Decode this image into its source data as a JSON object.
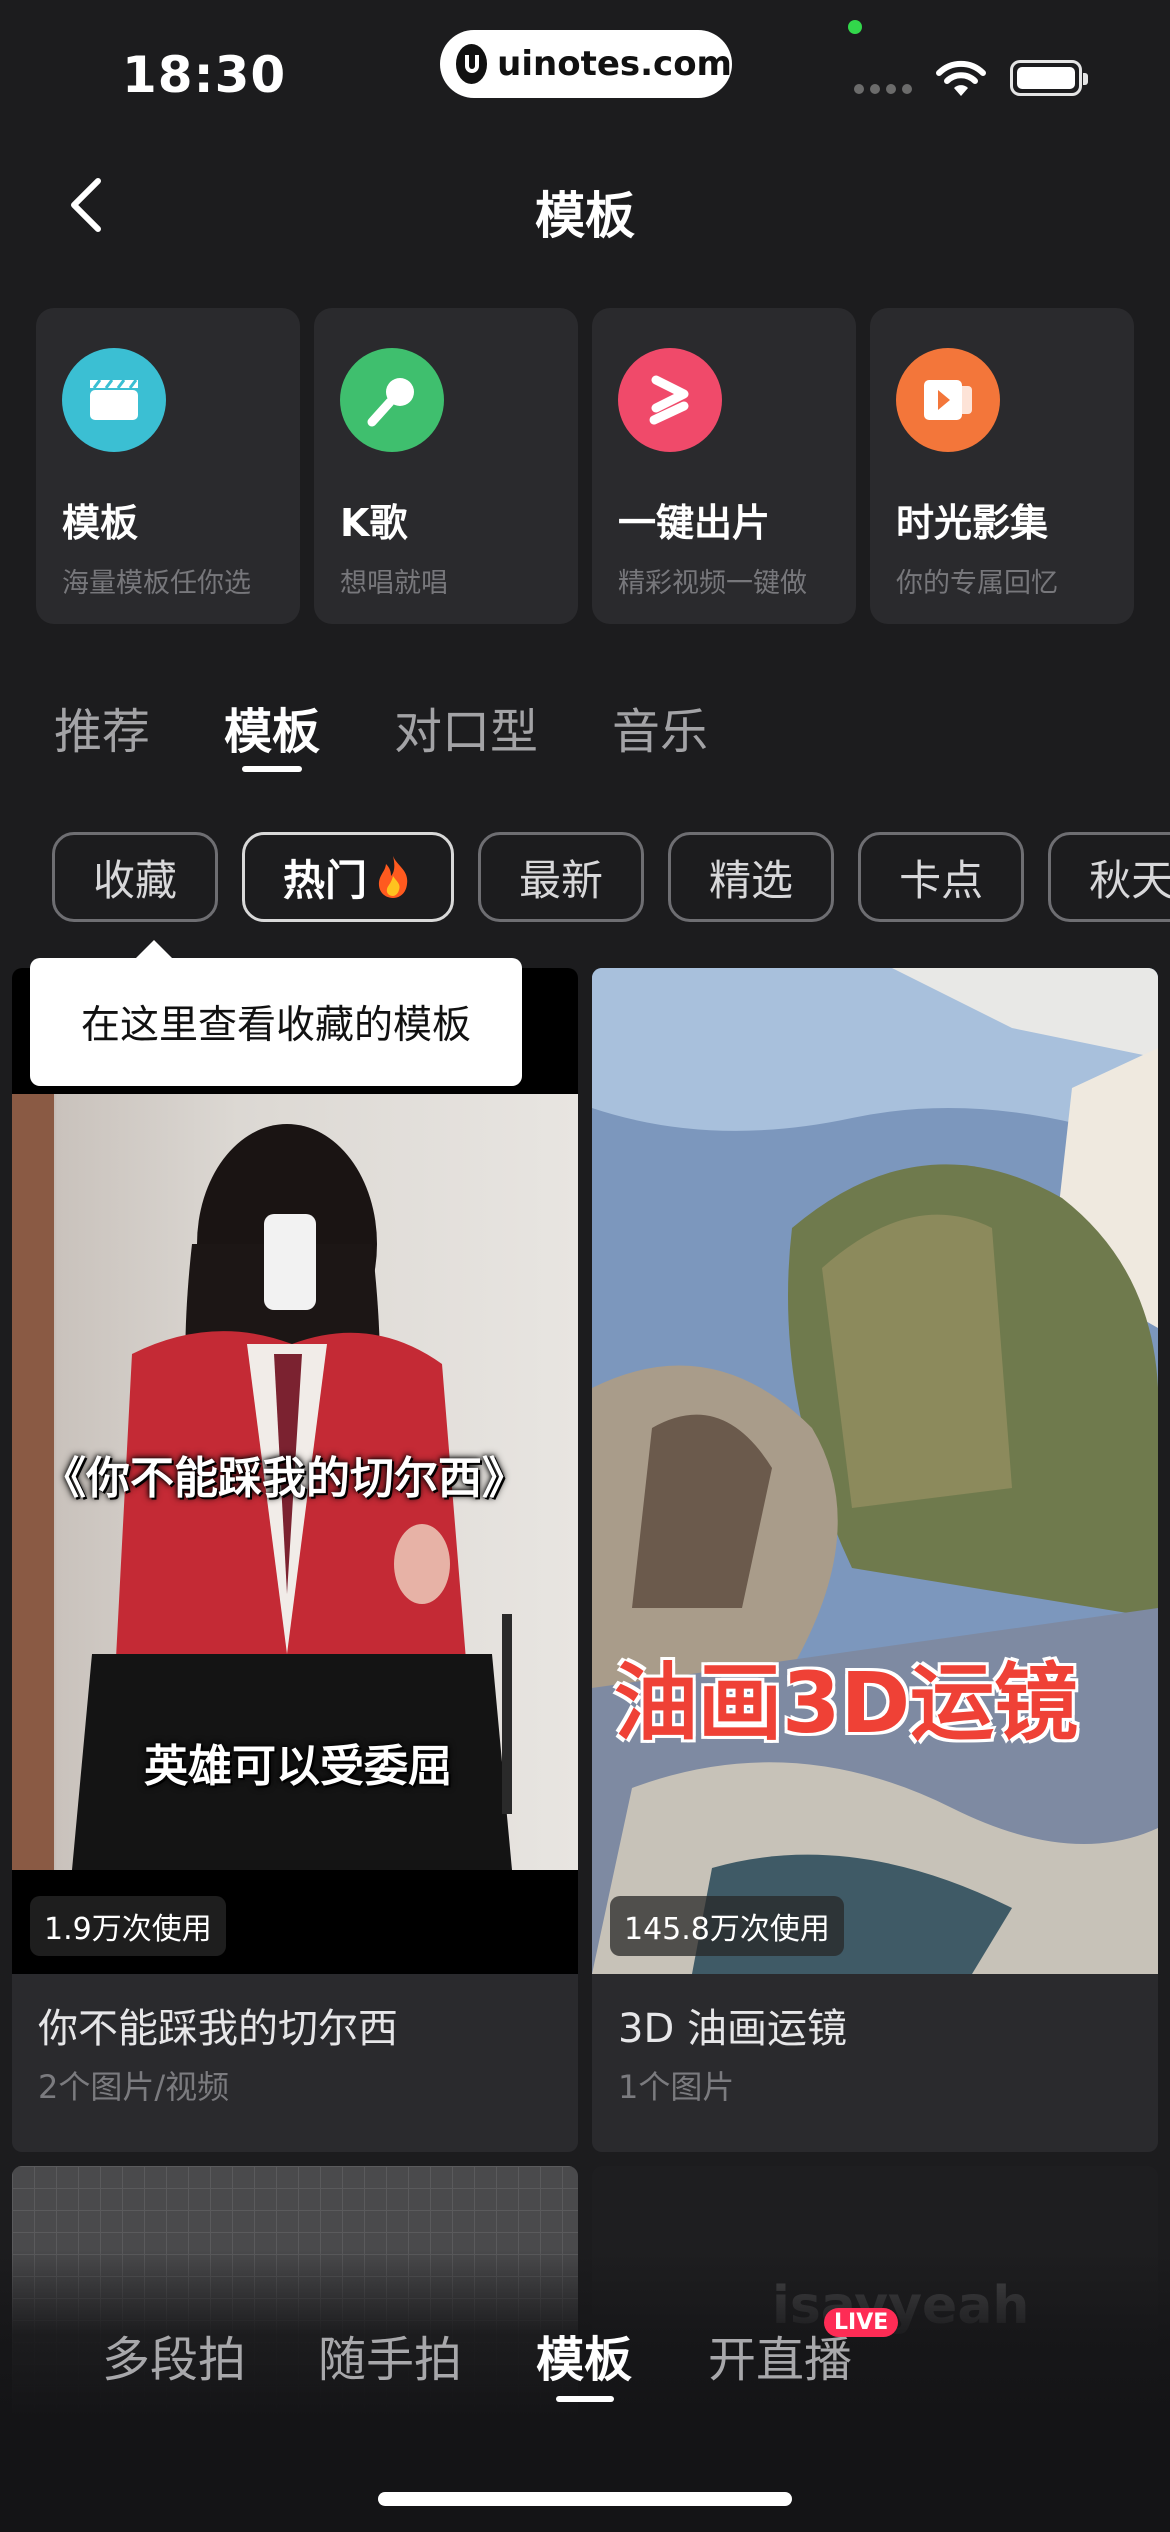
{
  "status": {
    "time": "18:30",
    "url": "uinotes.com"
  },
  "header": {
    "title": "模板"
  },
  "feature_cards": [
    {
      "title": "模板",
      "subtitle": "海量模板任你选",
      "icon": "clapperboard-icon",
      "color": "#3bbfd3"
    },
    {
      "title": "K歌",
      "subtitle": "想唱就唱",
      "icon": "microphone-icon",
      "color": "#3fbf6e"
    },
    {
      "title": "一键出片",
      "subtitle": "精彩视频一键做",
      "icon": "one-click-icon",
      "color": "#f04a6a"
    },
    {
      "title": "时光影集",
      "subtitle": "你的专属回忆",
      "icon": "album-icon",
      "color": "#f3763a"
    }
  ],
  "main_tabs": [
    {
      "label": "推荐",
      "active": false
    },
    {
      "label": "模板",
      "active": true
    },
    {
      "label": "对口型",
      "active": false
    },
    {
      "label": "音乐",
      "active": false
    }
  ],
  "chips": [
    {
      "label": "收藏",
      "active": false
    },
    {
      "label": "热门",
      "active": true
    },
    {
      "label": "最新",
      "active": false
    },
    {
      "label": "精选",
      "active": false
    },
    {
      "label": "卡点",
      "active": false
    },
    {
      "label": "秋天",
      "active": false
    }
  ],
  "tooltip": {
    "text": "在这里查看收藏的模板"
  },
  "templates": [
    {
      "title": "你不能踩我的切尔西",
      "meta": "2个图片/视频",
      "usage": "1.9万次使用",
      "overlay_top": "《你不能踩我的切尔西》",
      "overlay_bottom": "英雄可以受委屈"
    },
    {
      "title": "3D 油画运镜",
      "meta": "1个图片",
      "usage": "145.8万次使用",
      "overlay_top": "油画3D运镜"
    }
  ],
  "partial_tile_text": "isayyeah",
  "bottom_nav": [
    {
      "label": "多段拍",
      "active": false
    },
    {
      "label": "随手拍",
      "active": false
    },
    {
      "label": "模板",
      "active": true
    },
    {
      "label": "开直播",
      "active": false,
      "badge": "LIVE"
    }
  ]
}
